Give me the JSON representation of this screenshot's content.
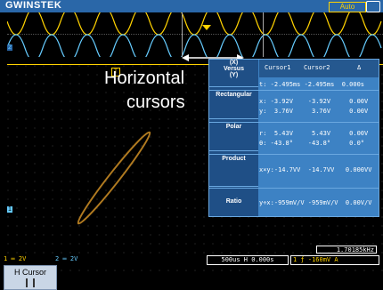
{
  "header": {
    "logo": "GWINSTEK",
    "mode_badge": "Auto"
  },
  "channels": {
    "ch1_marker": "1",
    "ch2_marker": "2"
  },
  "overlay": {
    "line1": "Horizontal",
    "line2": "cursors"
  },
  "cursor_panel": {
    "mode_label_top": "(X)",
    "mode_label_mid": "Versus",
    "mode_label_bot": "(Y)",
    "col1": "Cursor1",
    "col2": "Cursor2",
    "col3": "Δ",
    "time_row": "t: -2.495ms -2.495ms  0.000s",
    "rect_label": "Rectangular",
    "rect_x": "x: -3.92V    -3.92V     0.00V",
    "rect_y": "y:  3.76V     3.76V     0.00V",
    "polar_label": "Polar",
    "polar_r": "r:  5.43V     5.43V     0.00V",
    "polar_theta": "θ: -43.8°    -43.8°     0.0°",
    "product_label": "Product",
    "product_row": "x×y:-14.7VV  -14.7VV   0.000VV",
    "ratio_label": "Ratio",
    "ratio_row": "y÷x:-959mV/V -959mV/V  0.00V/V"
  },
  "status": {
    "ch1": "1 ═  2V",
    "ch2": "2 ═  2V",
    "timebase": "500us H  0.000s",
    "trigger": "1  ƒ  -160mV   A",
    "frequency": "1.70185kHz"
  },
  "softkey": {
    "label": "H Cursor"
  }
}
